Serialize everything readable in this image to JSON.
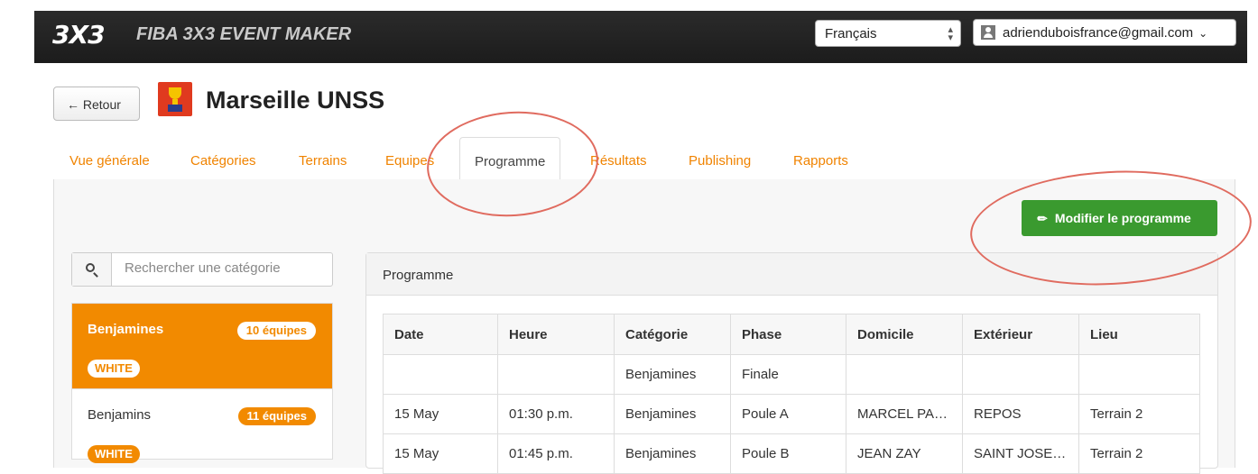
{
  "header": {
    "logo": "3X3",
    "app_title": "FIBA 3X3 EVENT MAKER",
    "language": "Français",
    "user_email": "adrienduboisfrance@gmail.com"
  },
  "event": {
    "back_label": "← Retour",
    "title": "Marseille UNSS"
  },
  "tabs": [
    {
      "label": "Vue générale"
    },
    {
      "label": "Catégories"
    },
    {
      "label": "Terrains"
    },
    {
      "label": "Equipes"
    },
    {
      "label": "Programme",
      "active": true
    },
    {
      "label": "Résultats"
    },
    {
      "label": "Publishing"
    },
    {
      "label": "Rapports"
    }
  ],
  "actions": {
    "edit_label": "Modifier le programme"
  },
  "search": {
    "placeholder": "Rechercher une catégorie"
  },
  "categories": [
    {
      "name": "Benjamines",
      "count": "10 équipes",
      "badge": "WHITE",
      "active": true
    },
    {
      "name": "Benjamins",
      "count": "11 équipes",
      "badge": "WHITE",
      "active": false
    }
  ],
  "programme": {
    "title": "Programme",
    "columns": [
      "Date",
      "Heure",
      "Catégorie",
      "Phase",
      "Domicile",
      "Extérieur",
      "Lieu"
    ],
    "rows": [
      [
        "",
        "",
        "Benjamines",
        "Finale",
        "",
        "",
        ""
      ],
      [
        "15 May",
        "01:30 p.m.",
        "Benjamines",
        "Poule A",
        "MARCEL PA…",
        "REPOS",
        "Terrain 2"
      ],
      [
        "15 May",
        "01:45 p.m.",
        "Benjamines",
        "Poule B",
        "JEAN ZAY",
        "SAINT JOSE…",
        "Terrain 2"
      ]
    ]
  },
  "colors": {
    "accent": "#f08300",
    "success": "#3a9a2f",
    "annotation": "#e06b5f"
  }
}
